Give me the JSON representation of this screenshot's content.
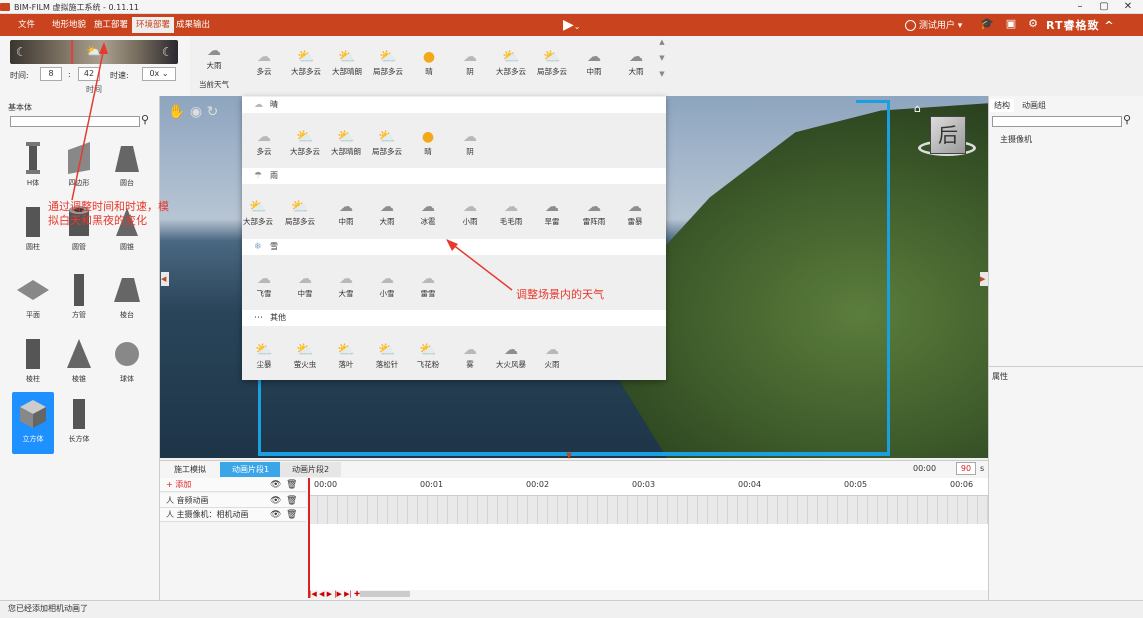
{
  "app": {
    "title": "BIM-FILM 虚拟施工系统 - 0.11.11"
  },
  "window_controls": {
    "min": "–",
    "max": "▢",
    "close": "✕"
  },
  "menu": {
    "items": [
      "文件",
      "地形地貌",
      "施工部署",
      "环境部署",
      "成果输出"
    ],
    "active_index": 3
  },
  "header": {
    "user": "测试用户",
    "brand": "RT睿格致"
  },
  "time_panel": {
    "label_time": "时间:",
    "hour": "8",
    "colon": ":",
    "minute": "42",
    "label_speed": "时速:",
    "speed": "0x",
    "section": "时间"
  },
  "current_weather": {
    "label": "大雨",
    "caption": "当前天气"
  },
  "weather_toolbar": [
    "多云",
    "大部多云",
    "大部晴朗",
    "局部多云",
    "晴",
    "阴",
    "大部多云",
    "局部多云",
    "中雨",
    "大雨"
  ],
  "weather_sections": [
    {
      "title": "晴",
      "items": [
        "多云",
        "大部多云",
        "大部晴朗",
        "局部多云",
        "晴",
        "阴"
      ]
    },
    {
      "title": "雨",
      "items": [
        "大部多云",
        "局部多云",
        "中雨",
        "大雨",
        "冰雹",
        "小雨",
        "毛毛雨",
        "旱雷",
        "雷阵雨",
        "雷暴"
      ]
    },
    {
      "title": "雪",
      "items": [
        "飞雪",
        "中雪",
        "大雪",
        "小雪",
        "雷雪"
      ]
    },
    {
      "title": "其他",
      "items": [
        "尘暴",
        "萤火虫",
        "落叶",
        "落松针",
        "飞花粉",
        "雾",
        "大火风暴",
        "火雨"
      ]
    }
  ],
  "left_panel": {
    "title": "基本体",
    "shapes": [
      "H体",
      "四边形",
      "圆台",
      "圆柱",
      "圆管",
      "圆锥",
      "平面",
      "方管",
      "棱台",
      "棱柱",
      "棱锥",
      "球体",
      "立方体",
      "长方体"
    ],
    "selected": "立方体"
  },
  "annotations": {
    "time": "通过调整时间和时速，模拟白天和黑夜的变化",
    "weather": "调整场景内的天气"
  },
  "right_panel": {
    "tabs": [
      "结构",
      "动画组"
    ],
    "items": [
      "主摄像机"
    ],
    "properties_label": "属性"
  },
  "viewport": {
    "nav_cube_label": "后"
  },
  "timeline": {
    "tabs": [
      "施工模拟",
      "动画片段1",
      "动画片段2"
    ],
    "active_tab": 1,
    "add_label": "+ 添加",
    "tracks": [
      "音频动画",
      "主摄像机：相机动画"
    ],
    "ticks": [
      "00:00",
      "00:01",
      "00:02",
      "00:03",
      "00:04",
      "00:05",
      "00:06"
    ],
    "current_time": "00:00",
    "duration": "90",
    "unit": "s",
    "controls": "|◀ ◀ ▶ |▶ ▶| ✚"
  },
  "status": {
    "text": "您已经添加相机动画了"
  }
}
